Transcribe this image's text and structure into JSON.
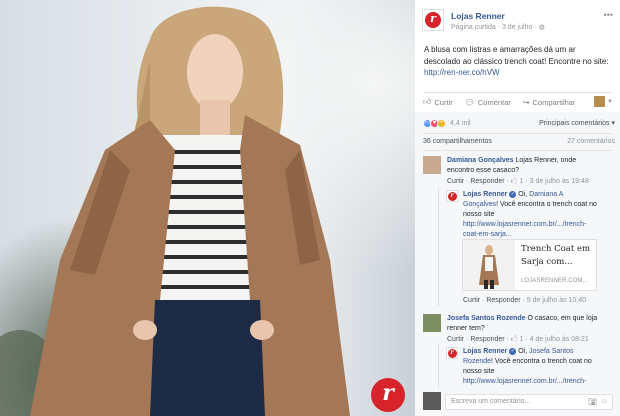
{
  "photo": {
    "logo_letter": "r"
  },
  "post": {
    "page_name": "Lojas Renner",
    "page_meta": "Página curtida · 3 de julho · ",
    "text_main": "A blusa com listras e amarrações dá um ar descolado ao clássico trench coat! Encontre no site: ",
    "text_link": "http://ren-ner.co/hVW",
    "actions": {
      "like": "Curtir",
      "comment": "Comentar",
      "share": "Compartilhar"
    },
    "reactions_count": "4,4 mil",
    "top_comments": "Principais comentários ▾",
    "shares_count": "36 compartilhamentos",
    "comments_count": "27 comentários"
  },
  "comments": [
    {
      "author": "Damiana Gonçalves",
      "text": " Lojas Renner, onde encontro esse casaco?",
      "like": "Curtir",
      "reply": "Responder",
      "meta": " · 🖒 1 · 3 de julho às 19:48"
    },
    {
      "author": "Lojas Renner",
      "text_prefix": " Oi, ",
      "tag": "Damiana A Gonçalves",
      "text": "! Você encontra o trench coat no nosso site",
      "link": "http://www.lojasrenner.com.br/.../trench-coat-em-sarja...",
      "card_title": "Trench Coat em Sarja com...",
      "card_domain": "LOJASRENNER.COM...",
      "like": "Curtir",
      "reply": "Responder",
      "meta": " · 5 de julho às 10:40"
    },
    {
      "author": "Josefa Santos Rozende",
      "text": " O casaco, em que loja renner tem?",
      "like": "Curtir",
      "reply": "Responder",
      "meta": " · 🖒 1 · 4 de julho às 08:21"
    },
    {
      "author": "Lojas Renner",
      "text_prefix": " Oi, ",
      "tag": "Josefa Santos Rozende",
      "text": "! Você encontra o trench coat no nosso site",
      "link": "http://www.lojasrenner.com.br/.../trench-coat-em-sarja..."
    }
  ],
  "comment_input": {
    "placeholder": "Escreva um comentário..."
  },
  "colors": {
    "brand_red": "#d6242a",
    "fb_link": "#365899"
  }
}
